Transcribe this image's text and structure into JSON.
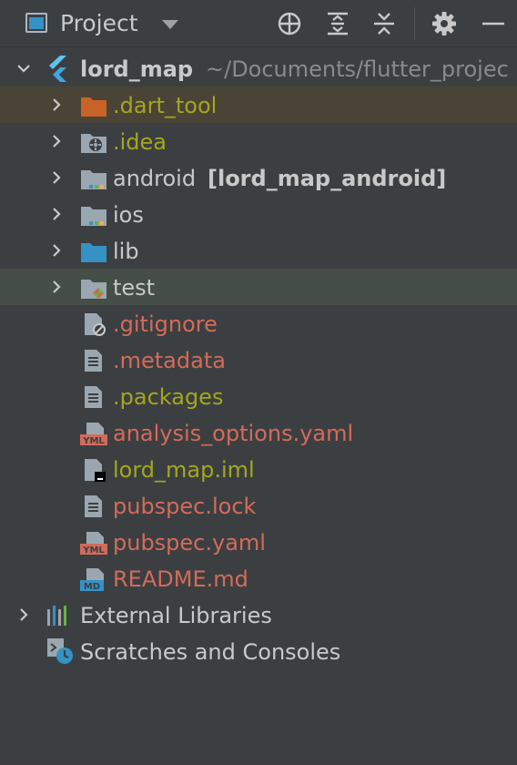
{
  "header": {
    "title": "Project",
    "icons": [
      "project-view-icon",
      "locate-icon",
      "expand-all-icon",
      "collapse-all-icon",
      "gear-icon",
      "minimize-icon"
    ]
  },
  "tree": {
    "root": {
      "name": "lord_map",
      "path": "~/Documents/flutter_projec"
    },
    "items": [
      {
        "label": ".dart_tool",
        "icon": "folder-excluded-icon"
      },
      {
        "label": ".idea",
        "icon": "folder-idea-icon"
      },
      {
        "label": "android",
        "suffix": "[lord_map_android]",
        "icon": "folder-module-icon"
      },
      {
        "label": "ios",
        "icon": "folder-module-icon"
      },
      {
        "label": "lib",
        "icon": "folder-source-icon"
      },
      {
        "label": "test",
        "icon": "folder-test-icon"
      },
      {
        "label": ".gitignore",
        "icon": "ignore-file-icon"
      },
      {
        "label": ".metadata",
        "icon": "text-file-icon"
      },
      {
        "label": ".packages",
        "icon": "text-file-icon"
      },
      {
        "label": "analysis_options.yaml",
        "icon": "yaml-file-icon"
      },
      {
        "label": "lord_map.iml",
        "icon": "iml-file-icon"
      },
      {
        "label": "pubspec.lock",
        "icon": "text-file-icon"
      },
      {
        "label": "pubspec.yaml",
        "icon": "yaml-file-icon"
      },
      {
        "label": "README.md",
        "icon": "markdown-file-icon"
      }
    ],
    "external_libraries": "External Libraries",
    "scratches": "Scratches and Consoles"
  },
  "colors": {
    "background": "#3c3f41",
    "excluded_row": "#4a4437",
    "selected_row": "#454e47",
    "olive_text": "#a5a61e",
    "red_text": "#d36b5a",
    "folder_blue": "#3592c4",
    "folder_orange": "#c86228"
  }
}
